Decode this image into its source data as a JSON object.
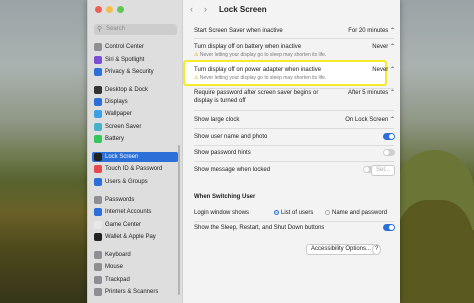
{
  "colors": {
    "accent": "#2c6fd9",
    "highlight": "#f4ea2a",
    "toggle_on": "#2c6fd9",
    "toggle_off": "#cfcfcf"
  },
  "sidebar": {
    "search_placeholder": "Search",
    "items": [
      {
        "label": "Control Center",
        "icon": "control-center-icon",
        "color": "#8e8e93"
      },
      {
        "label": "Siri & Spotlight",
        "icon": "siri-icon",
        "color": "#7a4fd6"
      },
      {
        "label": "Privacy & Security",
        "icon": "hand-icon",
        "color": "#2c6fd9"
      },
      {
        "label": "Desktop & Dock",
        "icon": "dock-icon",
        "color": "#333333"
      },
      {
        "label": "Displays",
        "icon": "display-icon",
        "color": "#2c6fd9"
      },
      {
        "label": "Wallpaper",
        "icon": "wallpaper-icon",
        "color": "#3aa0e8"
      },
      {
        "label": "Screen Saver",
        "icon": "screensaver-icon",
        "color": "#47b3c9"
      },
      {
        "label": "Battery",
        "icon": "battery-icon",
        "color": "#34c759"
      },
      {
        "label": "Lock Screen",
        "icon": "lock-icon",
        "color": "#222222"
      },
      {
        "label": "Touch ID & Password",
        "icon": "fingerprint-icon",
        "color": "#e5484d"
      },
      {
        "label": "Users & Groups",
        "icon": "users-icon",
        "color": "#2c6fd9"
      },
      {
        "label": "Passwords",
        "icon": "key-icon",
        "color": "#8e8e93"
      },
      {
        "label": "Internet Accounts",
        "icon": "at-icon",
        "color": "#2c6fd9"
      },
      {
        "label": "Game Center",
        "icon": "game-center-icon",
        "color": "#e8e8e8"
      },
      {
        "label": "Wallet & Apple Pay",
        "icon": "wallet-icon",
        "color": "#222222"
      },
      {
        "label": "Keyboard",
        "icon": "keyboard-icon",
        "color": "#8e8e93"
      },
      {
        "label": "Mouse",
        "icon": "mouse-icon",
        "color": "#8e8e93"
      },
      {
        "label": "Trackpad",
        "icon": "trackpad-icon",
        "color": "#8e8e93"
      },
      {
        "label": "Printers & Scanners",
        "icon": "printer-icon",
        "color": "#8e8e93"
      }
    ]
  },
  "header": {
    "back": "‹",
    "forward": "›",
    "title": "Lock Screen"
  },
  "settings": {
    "screen_saver": {
      "label": "Start Screen Saver when inactive",
      "value": "For 20 minutes"
    },
    "display_battery": {
      "label": "Turn display off on battery when inactive",
      "value": "Never",
      "warning": "Never letting your display go to sleep may shorten its life."
    },
    "display_power": {
      "label": "Turn display off on power adapter when inactive",
      "value": "Never",
      "warning": "Never letting your display go to sleep may shorten its life."
    },
    "require_password": {
      "label1": "Require password after screen saver begins or",
      "label2": "display is turned off",
      "value": "After 5 minutes"
    },
    "large_clock": {
      "label": "Show large clock",
      "value": "On Lock Screen"
    },
    "user_name": {
      "label": "Show user name and photo",
      "on": true
    },
    "password_hints": {
      "label": "Show password hints",
      "on": false
    },
    "message": {
      "label": "Show message when locked",
      "on": false,
      "set": "Set..."
    },
    "switching_header": "When Switching User",
    "login_window": {
      "label": "Login window shows",
      "option1": "List of users",
      "option2": "Name and password"
    },
    "sleep_buttons": {
      "label": "Show the Sleep, Restart, and Shut Down buttons",
      "on": true
    },
    "accessibility_btn": "Accessibility Options...",
    "help": "?"
  }
}
